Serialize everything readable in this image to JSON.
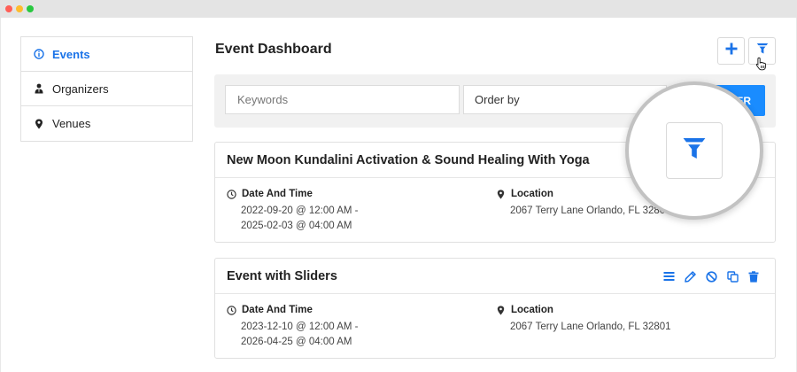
{
  "colors": {
    "accent": "#1a73e8",
    "button_blue": "#1a8cff",
    "icon_blue": "#1a73e8"
  },
  "sidebar": {
    "items": [
      {
        "label": "Events",
        "icon": "info-circle-icon",
        "active": true
      },
      {
        "label": "Organizers",
        "icon": "user-tie-icon",
        "active": false
      },
      {
        "label": "Venues",
        "icon": "map-pin-icon",
        "active": false
      }
    ]
  },
  "header": {
    "title": "Event Dashboard",
    "add_icon": "plus-icon",
    "filter_icon": "funnel-icon"
  },
  "search": {
    "keywords_placeholder": "Keywords",
    "order_by_value": "Order by",
    "submit_label": "ER"
  },
  "events": [
    {
      "title": "New Moon Kundalini Activation & Sound Healing With Yoga",
      "date_label": "Date And Time",
      "date_line1": "2022-09-20 @ 12:00 AM -",
      "date_line2": "2025-02-03 @ 04:00 AM",
      "location_label": "Location",
      "location_value": "2067 Terry Lane Orlando, FL 32801"
    },
    {
      "title": "Event with Sliders",
      "date_label": "Date And Time",
      "date_line1": "2023-12-10 @ 12:00 AM -",
      "date_line2": "2026-04-25 @ 04:00 AM",
      "location_label": "Location",
      "location_value": "2067 Terry Lane Orlando, FL 32801",
      "actions": [
        "list-icon",
        "edit-pencil-icon",
        "ban-icon",
        "copy-icon",
        "trash-icon"
      ]
    }
  ]
}
